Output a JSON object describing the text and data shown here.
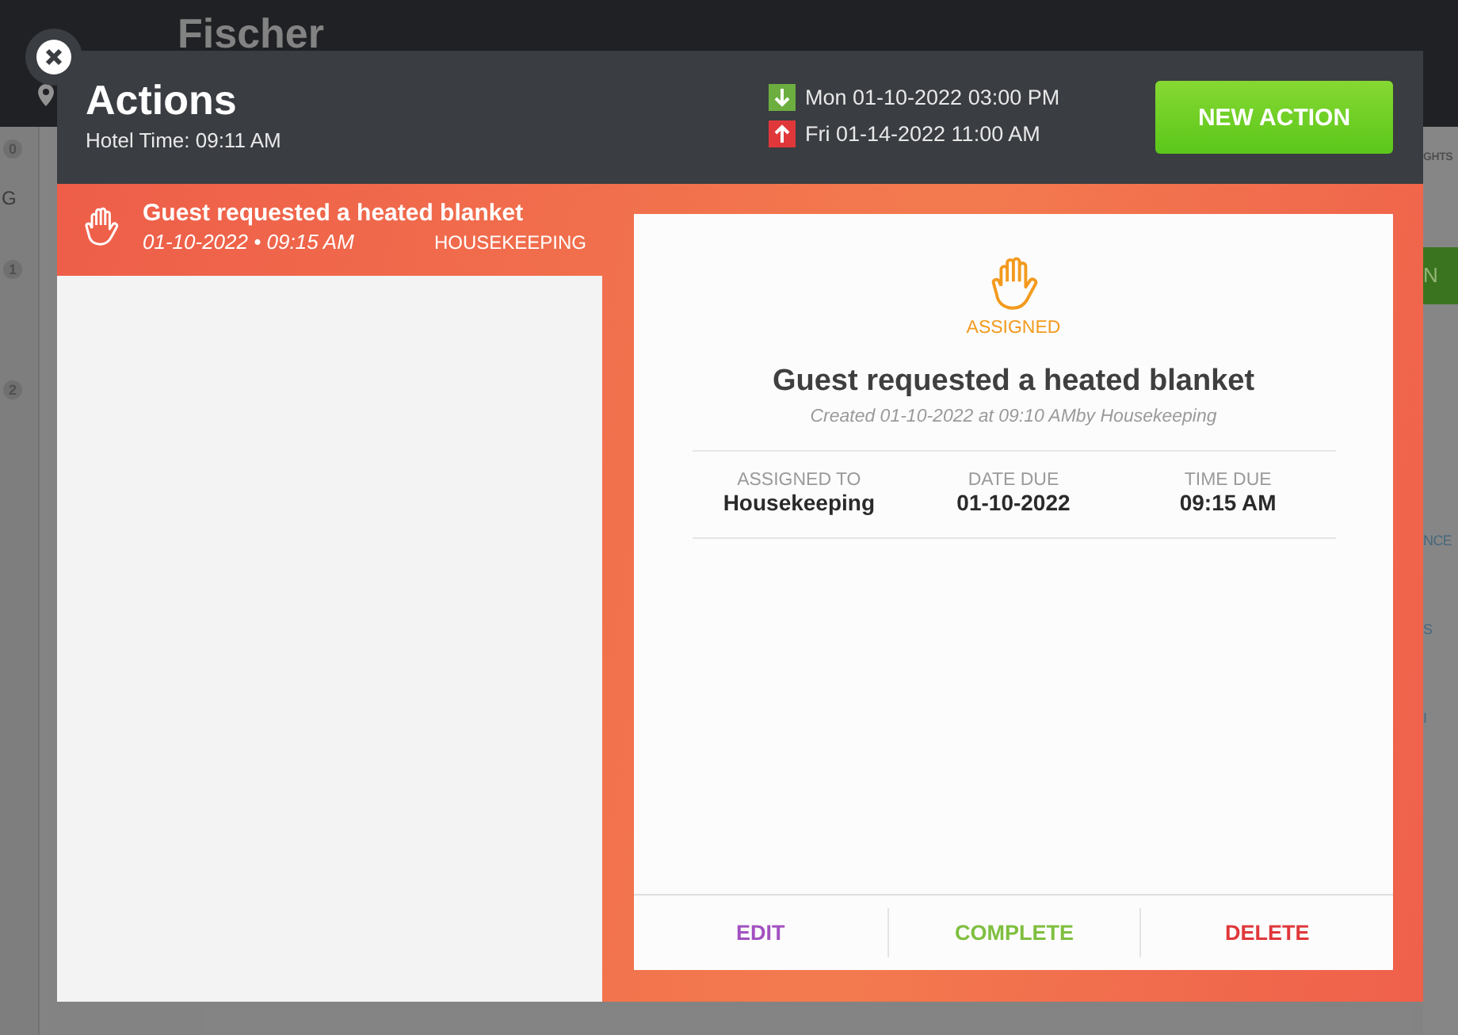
{
  "background": {
    "guest_name": "Fischer",
    "step_badges": [
      "0",
      "1",
      "2"
    ],
    "left_fragment": "G",
    "right_fragments": [
      {
        "kind": "tab",
        "text": "GHTS"
      },
      {
        "kind": "button",
        "text": "N"
      },
      {
        "kind": "link",
        "text": "NCE"
      },
      {
        "kind": "link",
        "text": "S"
      },
      {
        "kind": "link",
        "text": "I"
      }
    ]
  },
  "modal": {
    "title": "Actions",
    "hotel_time": "Hotel Time: 09:11 AM",
    "stay_dates": [
      {
        "kind": "arrival",
        "text": "Mon 01-10-2022 03:00 PM"
      },
      {
        "kind": "departure",
        "text": "Fri 01-14-2022 11:00 AM"
      }
    ],
    "new_action_button": "NEW ACTION"
  },
  "action_list": [
    {
      "title": "Guest requested a heated blanket",
      "due": "01-10-2022 • 09:15 AM",
      "department": "HOUSEKEEPING",
      "selected": true
    }
  ],
  "detail": {
    "status": "ASSIGNED",
    "title": "Guest requested a heated blanket",
    "created": "Created 01-10-2022 at 09:10 AMby Housekeeping",
    "fields": [
      {
        "label": "ASSIGNED TO",
        "value": "Housekeeping"
      },
      {
        "label": "DATE DUE",
        "value": "01-10-2022"
      },
      {
        "label": "TIME DUE",
        "value": "09:15 AM"
      }
    ],
    "buttons": [
      {
        "kind": "edit",
        "label": "EDIT"
      },
      {
        "kind": "complete",
        "label": "COMPLETE"
      },
      {
        "kind": "delete",
        "label": "DELETE"
      }
    ]
  }
}
